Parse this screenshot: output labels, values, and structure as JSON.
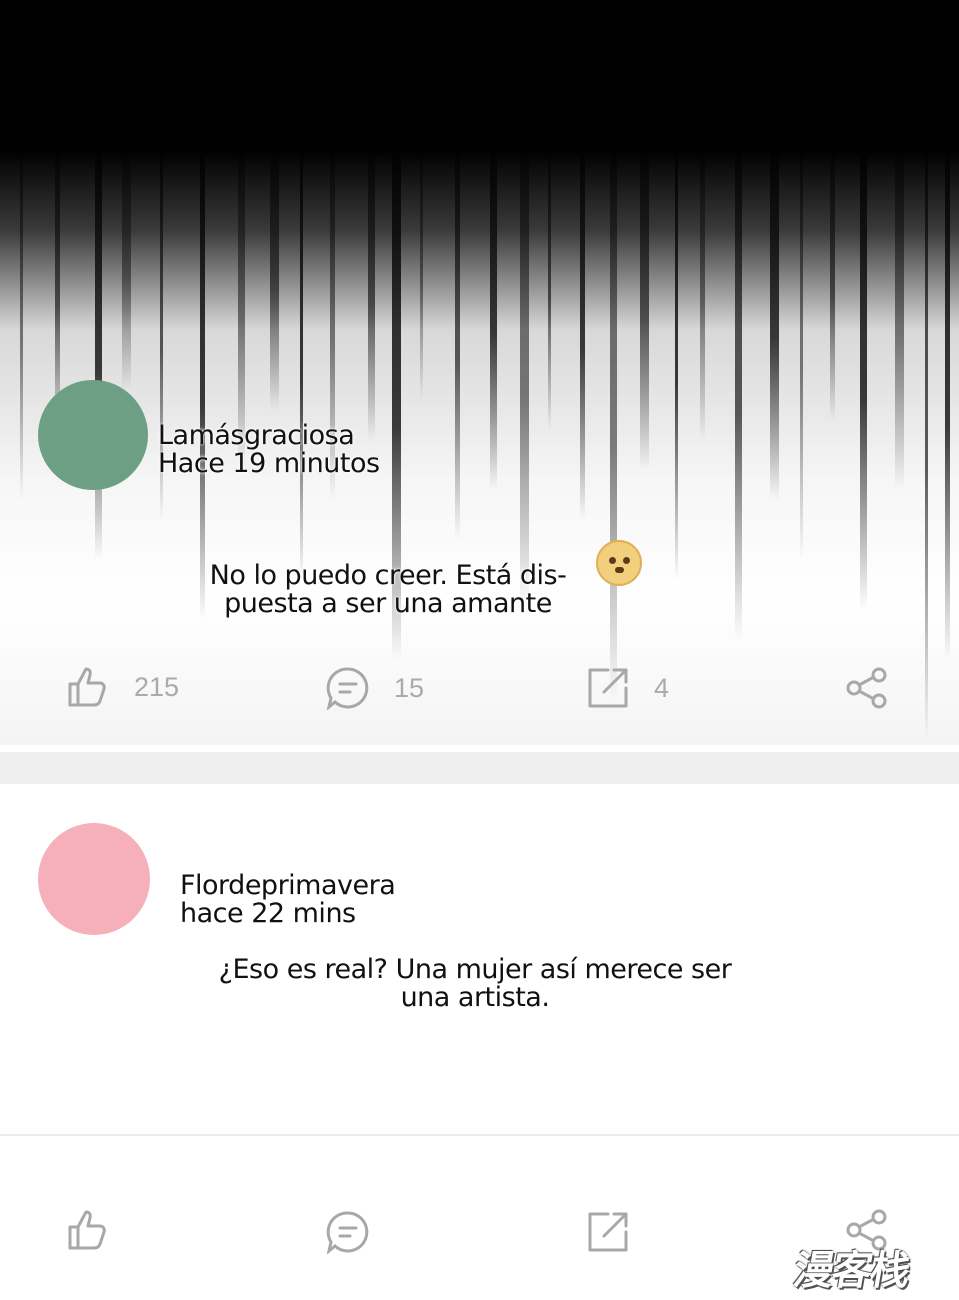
{
  "comments": [
    {
      "username": "Lamásgraciosa",
      "time": "Hace 19 minutos",
      "text_line1": "No lo puedo creer. Está dis-",
      "text_line2": "puesta a ser una amante",
      "avatar_color": "#6d9f84",
      "emoji": "doge-emoji",
      "actions": {
        "likes": "215",
        "comments": "15",
        "shares": "4"
      }
    },
    {
      "username": "Flordeprimavera",
      "time": "hace 22 mins",
      "text_line1": "¿Eso es real? Una mujer así merece ser",
      "text_line2": "una artista.",
      "avatar_color": "#f6b0ba"
    }
  ],
  "icons": [
    "thumbs-up-icon",
    "comment-icon",
    "share-out-icon",
    "share-nodes-icon"
  ],
  "watermark": "漫客栈",
  "colors": {
    "icon_gray": "#a8a8a8",
    "count_gray": "#aaaaaa"
  }
}
